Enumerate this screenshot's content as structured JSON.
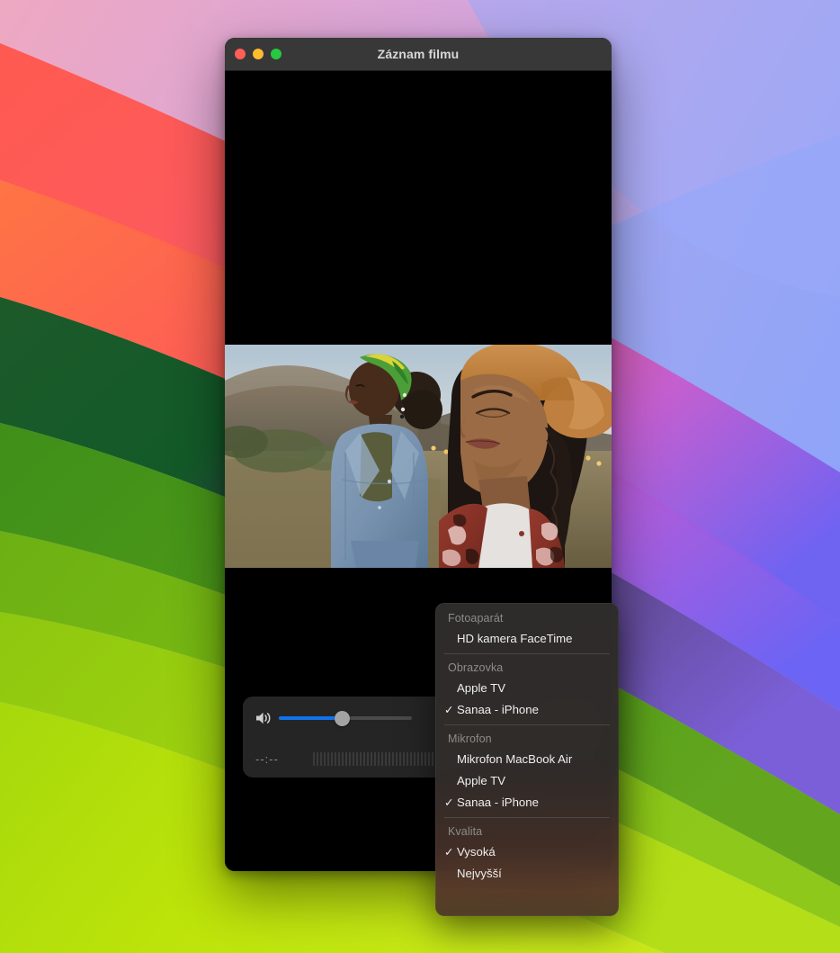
{
  "window": {
    "title": "Záznam filmu",
    "traffic_lights": [
      {
        "name": "close",
        "color": "#ff5f57"
      },
      {
        "name": "minimize",
        "color": "#febc2e"
      },
      {
        "name": "zoom",
        "color": "#28c840"
      }
    ]
  },
  "controls": {
    "volume_icon": "speaker-icon",
    "volume_value": 47,
    "record_button_label": "record-button",
    "timecode": "--:--",
    "waveform_bars": 46
  },
  "menu": {
    "sections": [
      {
        "title": "Fotoaparát",
        "items": [
          {
            "label": "HD kamera FaceTime",
            "checked": false
          }
        ]
      },
      {
        "title": "Obrazovka",
        "items": [
          {
            "label": "Apple TV",
            "checked": false
          },
          {
            "label": "Sanaa - iPhone",
            "checked": true
          }
        ]
      },
      {
        "title": "Mikrofon",
        "items": [
          {
            "label": "Mikrofon MacBook Air",
            "checked": false
          },
          {
            "label": "Apple TV",
            "checked": false
          },
          {
            "label": "Sanaa - iPhone",
            "checked": true
          }
        ]
      },
      {
        "title": "Kvalita",
        "items": [
          {
            "label": "Vysoká",
            "checked": true
          },
          {
            "label": "Nejvyšší",
            "checked": false
          }
        ]
      }
    ],
    "check_glyph": "✓"
  },
  "colors": {
    "accent_blue": "#1272ec",
    "record_red": "#f02a18",
    "menu_group_text": "#8e8c8a",
    "titlebar": "#383838"
  }
}
